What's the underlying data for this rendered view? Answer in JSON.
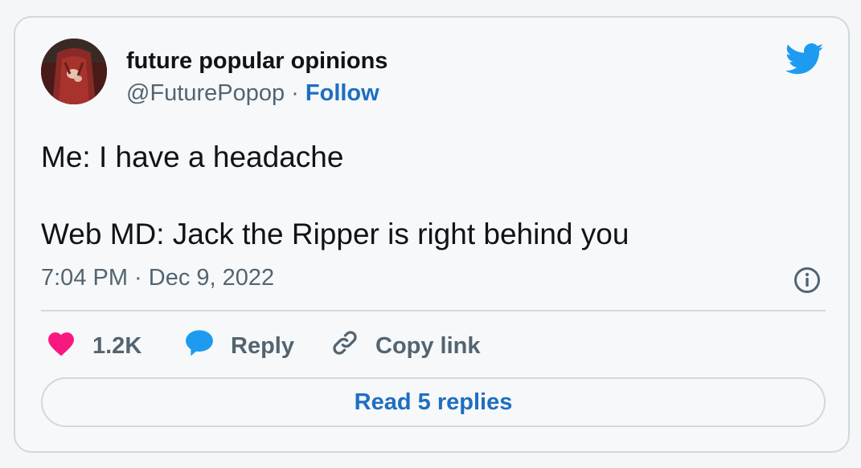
{
  "author": {
    "name": "future popular opinions",
    "handle": "@FuturePopop",
    "separator": " · ",
    "follow_label": "Follow"
  },
  "tweet": {
    "text": "Me: I have a headache\n\nWeb MD: Jack the Ripper is right behind you",
    "timestamp": "7:04 PM · Dec 9, 2022"
  },
  "actions": {
    "like_count": "1.2K",
    "reply_label": "Reply",
    "copy_link_label": "Copy link"
  },
  "read_replies_label": "Read 5 replies",
  "icons": {
    "brand": "twitter-bird-icon",
    "info": "info-icon",
    "like": "heart-icon",
    "reply": "speech-bubble-icon",
    "copy": "link-icon"
  },
  "colors": {
    "text_primary": "#0f1419",
    "text_secondary": "#536471",
    "link_blue": "#1d6fc2",
    "twitter_blue": "#1d9bf0",
    "like_pink": "#f91880",
    "border": "#cfd9de",
    "background": "#f7f8f9"
  }
}
